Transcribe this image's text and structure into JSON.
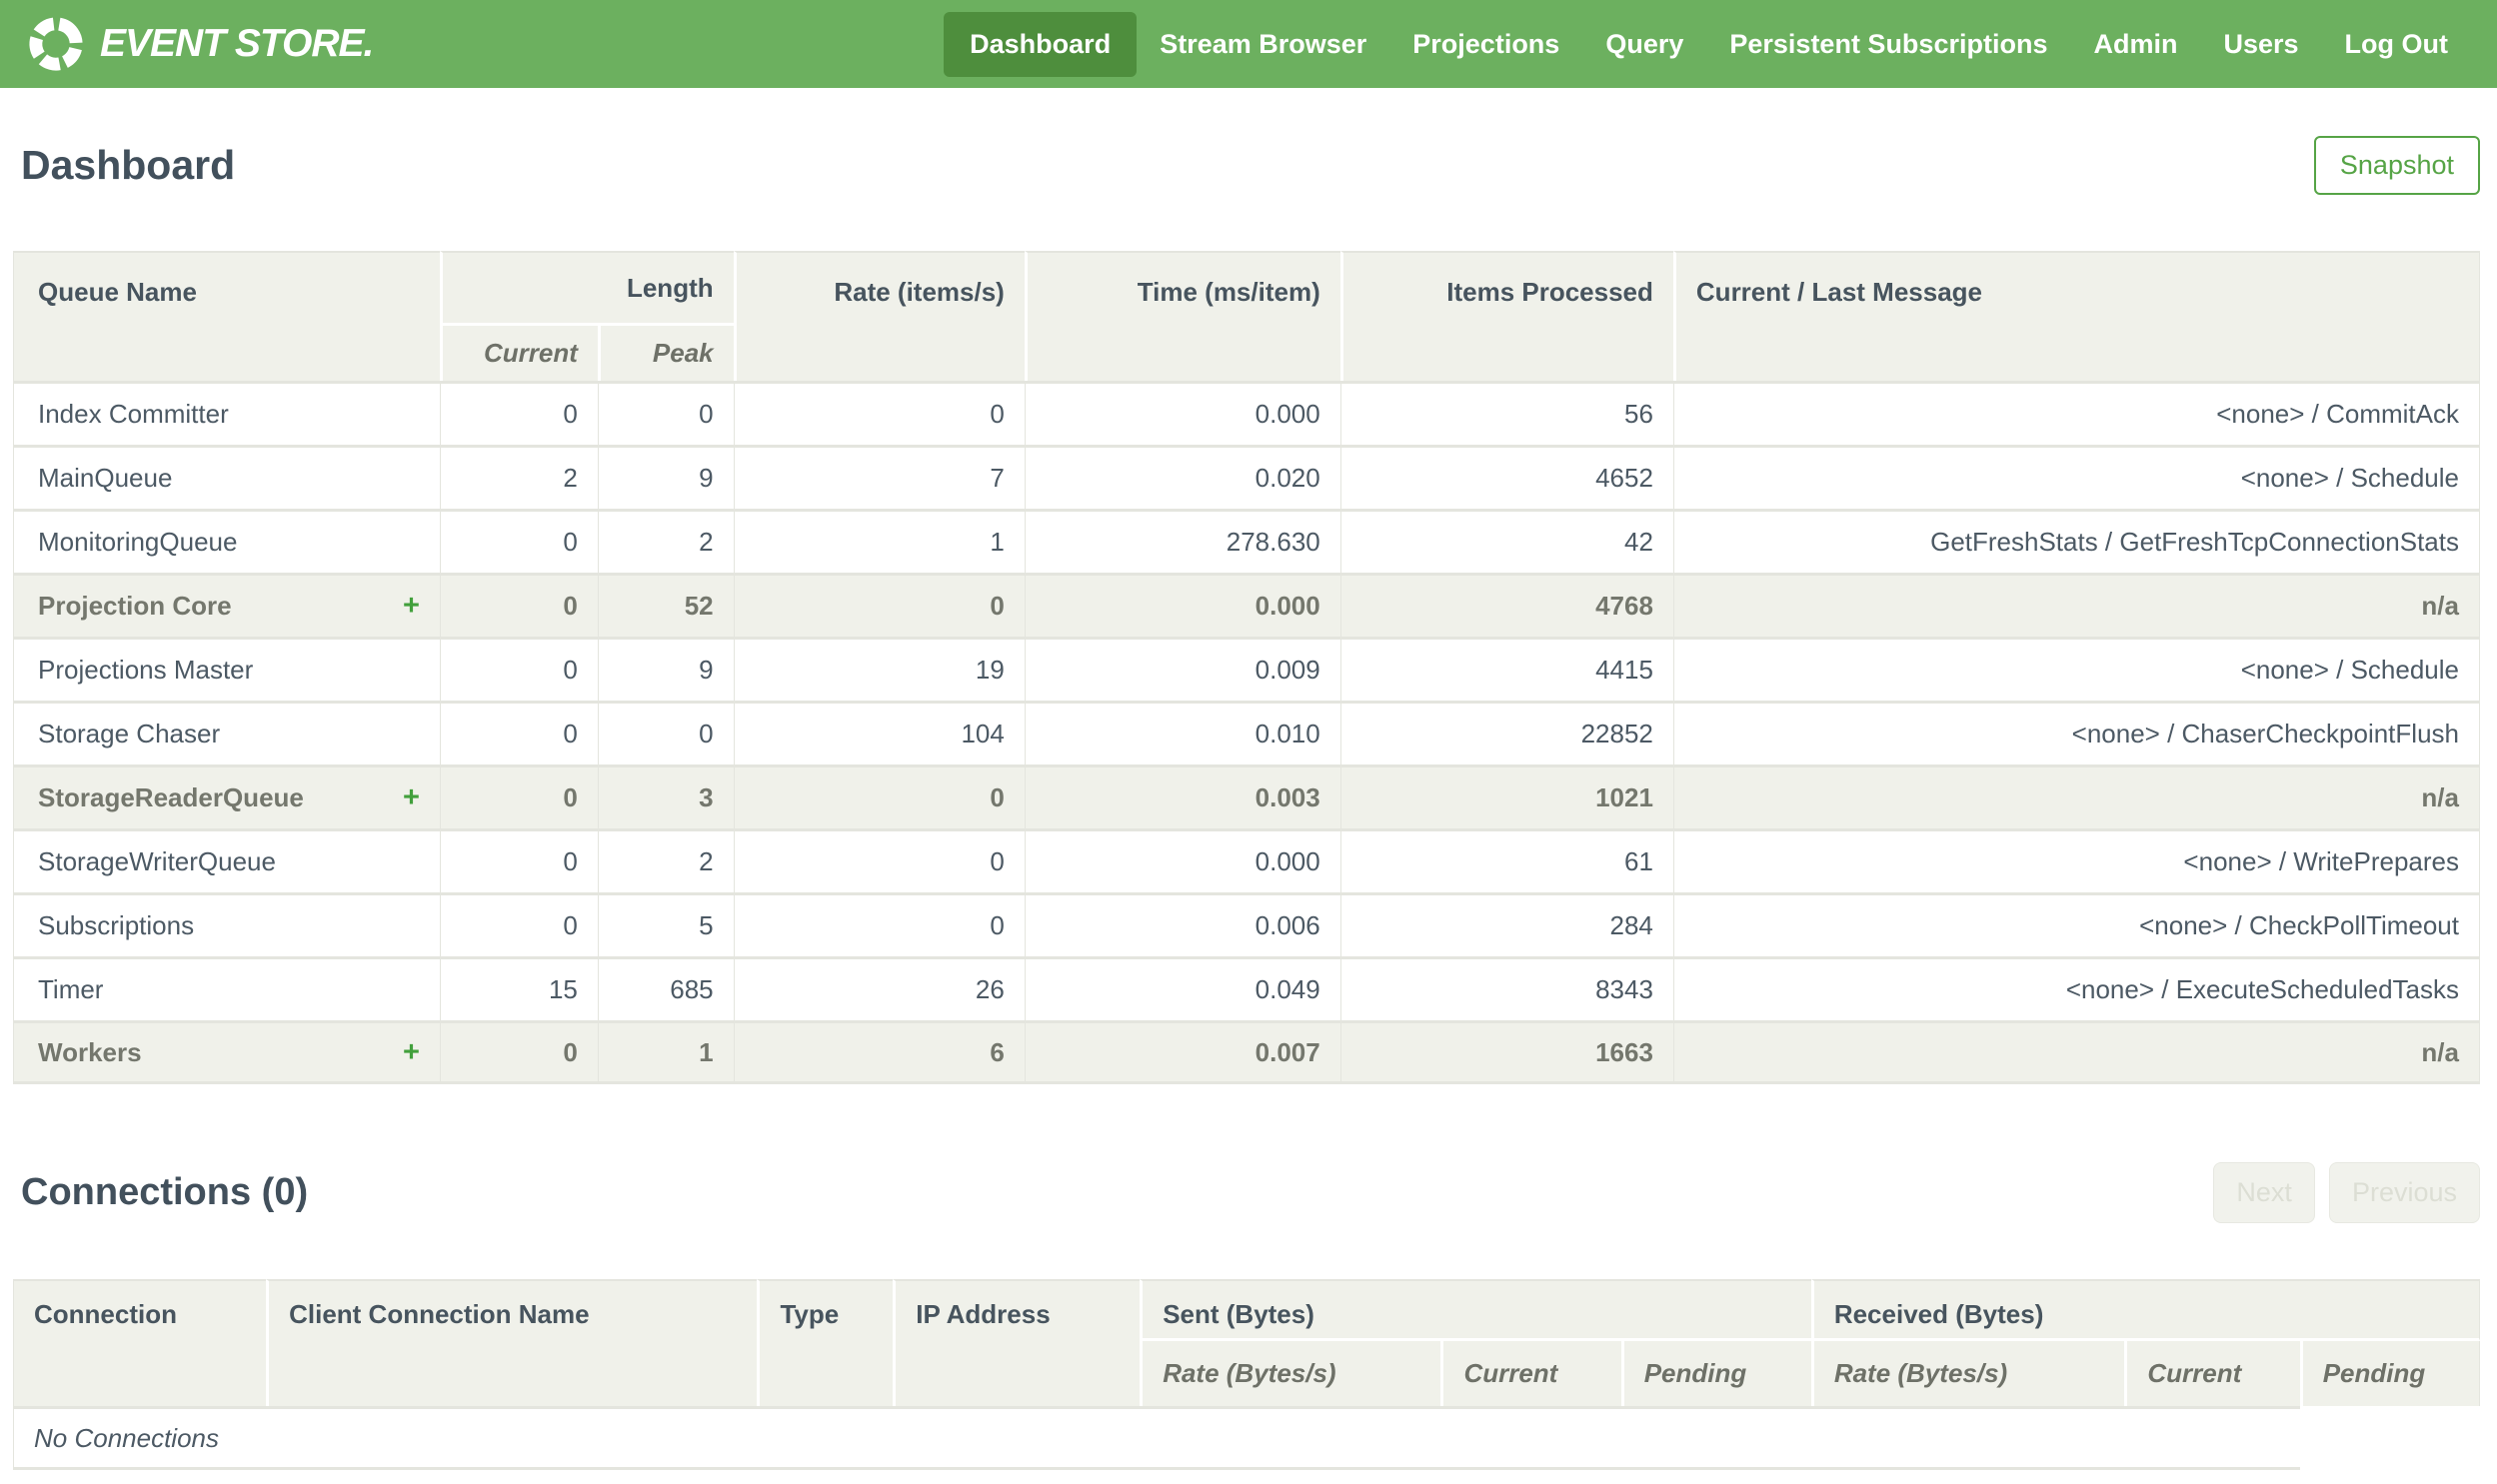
{
  "brand": {
    "name": "EVENT STORE."
  },
  "nav": {
    "items": [
      {
        "label": "Dashboard",
        "active": true
      },
      {
        "label": "Stream Browser",
        "active": false
      },
      {
        "label": "Projections",
        "active": false
      },
      {
        "label": "Query",
        "active": false
      },
      {
        "label": "Persistent Subscriptions",
        "active": false
      },
      {
        "label": "Admin",
        "active": false
      },
      {
        "label": "Users",
        "active": false
      },
      {
        "label": "Log Out",
        "active": false
      }
    ]
  },
  "page": {
    "title": "Dashboard",
    "snapshot_button": "Snapshot"
  },
  "queues": {
    "headers": {
      "queue_name": "Queue Name",
      "length": "Length",
      "length_current": "Current",
      "length_peak": "Peak",
      "rate": "Rate (items/s)",
      "time": "Time (ms/item)",
      "items_processed": "Items Processed",
      "message": "Current / Last Message"
    },
    "expand_symbol": "+",
    "rows": [
      {
        "name": "Index Committer",
        "group": false,
        "current": "0",
        "peak": "0",
        "rate": "0",
        "time": "0.000",
        "items": "56",
        "message": "<none> / CommitAck"
      },
      {
        "name": "MainQueue",
        "group": false,
        "current": "2",
        "peak": "9",
        "rate": "7",
        "time": "0.020",
        "items": "4652",
        "message": "<none> / Schedule"
      },
      {
        "name": "MonitoringQueue",
        "group": false,
        "current": "0",
        "peak": "2",
        "rate": "1",
        "time": "278.630",
        "items": "42",
        "message": "GetFreshStats / GetFreshTcpConnectionStats"
      },
      {
        "name": "Projection Core",
        "group": true,
        "current": "0",
        "peak": "52",
        "rate": "0",
        "time": "0.000",
        "items": "4768",
        "message": "n/a"
      },
      {
        "name": "Projections Master",
        "group": false,
        "current": "0",
        "peak": "9",
        "rate": "19",
        "time": "0.009",
        "items": "4415",
        "message": "<none> / Schedule"
      },
      {
        "name": "Storage Chaser",
        "group": false,
        "current": "0",
        "peak": "0",
        "rate": "104",
        "time": "0.010",
        "items": "22852",
        "message": "<none> / ChaserCheckpointFlush"
      },
      {
        "name": "StorageReaderQueue",
        "group": true,
        "current": "0",
        "peak": "3",
        "rate": "0",
        "time": "0.003",
        "items": "1021",
        "message": "n/a"
      },
      {
        "name": "StorageWriterQueue",
        "group": false,
        "current": "0",
        "peak": "2",
        "rate": "0",
        "time": "0.000",
        "items": "61",
        "message": "<none> / WritePrepares"
      },
      {
        "name": "Subscriptions",
        "group": false,
        "current": "0",
        "peak": "5",
        "rate": "0",
        "time": "0.006",
        "items": "284",
        "message": "<none> / CheckPollTimeout"
      },
      {
        "name": "Timer",
        "group": false,
        "current": "15",
        "peak": "685",
        "rate": "26",
        "time": "0.049",
        "items": "8343",
        "message": "<none> / ExecuteScheduledTasks"
      },
      {
        "name": "Workers",
        "group": true,
        "current": "0",
        "peak": "1",
        "rate": "6",
        "time": "0.007",
        "items": "1663",
        "message": "n/a"
      }
    ]
  },
  "connections": {
    "title": "Connections (0)",
    "next_button": "Next",
    "previous_button": "Previous",
    "headers": {
      "connection": "Connection",
      "client_name": "Client Connection Name",
      "type": "Type",
      "ip": "IP Address",
      "sent": "Sent (Bytes)",
      "received": "Received (Bytes)",
      "rate": "Rate (Bytes/s)",
      "current": "Current",
      "pending": "Pending"
    },
    "empty_message": "No Connections"
  },
  "colors": {
    "nav_green": "#6CB05F",
    "nav_active_green": "#4E8E3D",
    "accent_green": "#56A446",
    "plus_green": "#42A03C",
    "header_bg": "#F0F1EA",
    "border_gray": "#E4E5DE",
    "text_dark": "#42505C"
  }
}
